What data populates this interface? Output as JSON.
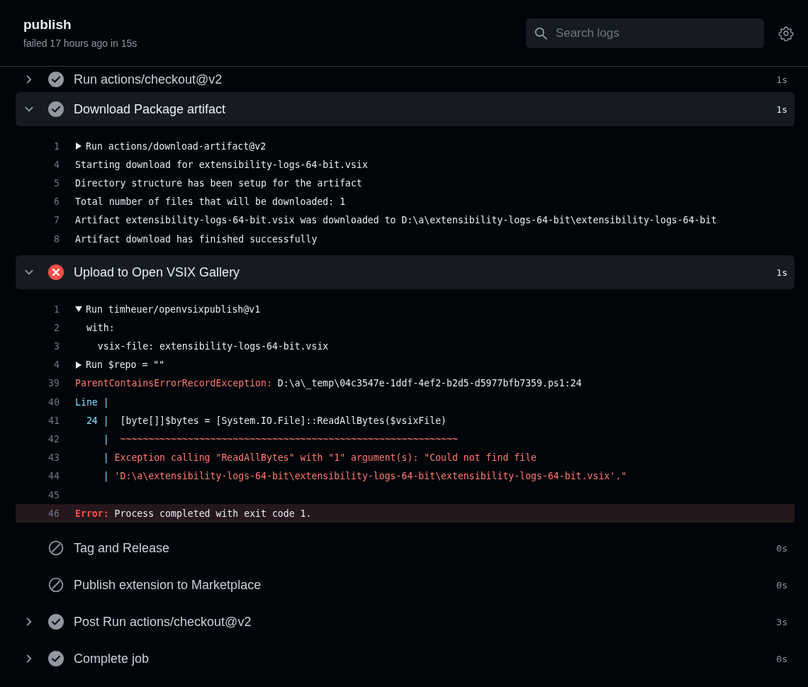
{
  "header": {
    "title": "publish",
    "subtitle": "failed 17 hours ago in 15s",
    "search": {
      "placeholder": "Search logs"
    }
  },
  "steps": [
    {
      "name": "Run actions/checkout@v2",
      "kind": "success",
      "expanded": false,
      "duration": "1s"
    },
    {
      "name": "Download Package artifact",
      "kind": "success",
      "expanded": true,
      "duration": "1s",
      "lines": [
        {
          "num": "1",
          "kind": "group",
          "expanded": false,
          "segments": [
            {
              "text": "Run actions/download-artifact@v2",
              "kind": "plain"
            }
          ]
        },
        {
          "num": "4",
          "kind": "text",
          "segments": [
            {
              "text": "Starting download for extensibility-logs-64-bit.vsix",
              "kind": "plain"
            }
          ]
        },
        {
          "num": "5",
          "kind": "text",
          "segments": [
            {
              "text": "Directory structure has been setup for the artifact",
              "kind": "plain"
            }
          ]
        },
        {
          "num": "6",
          "kind": "text",
          "segments": [
            {
              "text": "Total number of files that will be downloaded: 1",
              "kind": "plain"
            }
          ]
        },
        {
          "num": "7",
          "kind": "text",
          "segments": [
            {
              "text": "Artifact extensibility-logs-64-bit.vsix was downloaded to D:\\a\\extensibility-logs-64-bit\\extensibility-logs-64-bit",
              "kind": "plain"
            }
          ]
        },
        {
          "num": "8",
          "kind": "text",
          "segments": [
            {
              "text": "Artifact download has finished successfully",
              "kind": "plain"
            }
          ]
        }
      ]
    },
    {
      "name": "Upload to Open VSIX Gallery",
      "kind": "failure",
      "expanded": true,
      "duration": "1s",
      "lines": [
        {
          "num": "1",
          "kind": "group",
          "expanded": true,
          "segments": [
            {
              "text": "Run timheuer/openvsixpublish@v1",
              "kind": "plain"
            }
          ]
        },
        {
          "num": "2",
          "kind": "text",
          "segments": [
            {
              "text": "  with:",
              "kind": "plain"
            }
          ]
        },
        {
          "num": "3",
          "kind": "text",
          "segments": [
            {
              "text": "    vsix-file: extensibility-logs-64-bit.vsix",
              "kind": "plain"
            }
          ]
        },
        {
          "num": "4",
          "kind": "group",
          "expanded": false,
          "segments": [
            {
              "text": "Run $repo = \"\"",
              "kind": "plain"
            }
          ]
        },
        {
          "num": "39",
          "kind": "text",
          "segments": [
            {
              "text": "ParentContainsErrorRecordException:",
              "kind": "error"
            },
            {
              "text": " D:\\a\\_temp\\04c3547e-1ddf-4ef2-b2d5-d5977bfb7359.ps1:24",
              "kind": "plain"
            }
          ]
        },
        {
          "num": "40",
          "kind": "text",
          "segments": [
            {
              "text": "Line |",
              "kind": "accent"
            }
          ]
        },
        {
          "num": "41",
          "kind": "text",
          "segments": [
            {
              "text": "  24 |",
              "kind": "accent"
            },
            {
              "text": "  [byte[]]$bytes = [System.IO.File]::ReadAllBytes($vsixFile)",
              "kind": "plain"
            }
          ]
        },
        {
          "num": "42",
          "kind": "text",
          "segments": [
            {
              "text": "     |",
              "kind": "accent"
            },
            {
              "text": "  ~~~~~~~~~~~~~~~~~~~~~~~~~~~~~~~~~~~~~~~~~~~~~~~~~~~~~~~~~~~~",
              "kind": "error"
            }
          ]
        },
        {
          "num": "43",
          "kind": "text",
          "segments": [
            {
              "text": "     |",
              "kind": "accent"
            },
            {
              "text": " Exception calling \"ReadAllBytes\" with \"1\" argument(s): \"Could not find file",
              "kind": "error"
            }
          ]
        },
        {
          "num": "44",
          "kind": "text",
          "segments": [
            {
              "text": "     |",
              "kind": "accent"
            },
            {
              "text": " 'D:\\a\\extensibility-logs-64-bit\\extensibility-logs-64-bit\\extensibility-logs-64-bit.vsix'.\"",
              "kind": "error"
            }
          ]
        },
        {
          "num": "45",
          "kind": "text"
        },
        {
          "num": "46",
          "kind": "text",
          "highlighted": true,
          "segments": [
            {
              "text": "Error:",
              "kind": "error-bold"
            },
            {
              "text": " Process completed with exit code 1.",
              "kind": "plain"
            }
          ]
        }
      ]
    },
    {
      "name": "Tag and Release",
      "kind": "skipped",
      "duration": "0s"
    },
    {
      "name": "Publish extension to Marketplace",
      "kind": "skipped",
      "duration": "0s"
    },
    {
      "name": "Post Run actions/checkout@v2",
      "kind": "success",
      "expanded": false,
      "duration": "3s"
    },
    {
      "name": "Complete job",
      "kind": "success",
      "expanded": false,
      "duration": "0s"
    }
  ]
}
